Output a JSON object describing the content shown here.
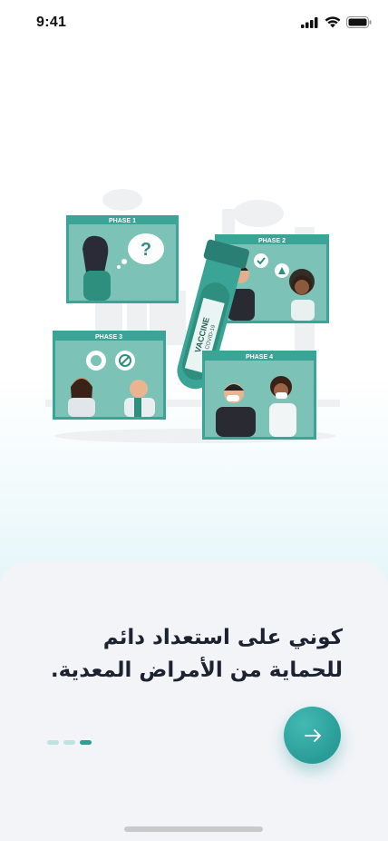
{
  "status_bar": {
    "time": "9:41",
    "signal_icon": "cellular-signal-icon",
    "wifi_icon": "wifi-icon",
    "battery_icon": "battery-icon"
  },
  "illustration": {
    "phases": [
      "PHASE 1",
      "PHASE 2",
      "PHASE 3",
      "PHASE 4"
    ],
    "vial_label": "VACCINE",
    "vial_sublabel": "COVID-19"
  },
  "onboarding": {
    "headline_line1": "كوني على استعداد دائم",
    "headline_line2": "للحماية من الأمراض المعدية.",
    "pager": {
      "total": 3,
      "active": 3
    },
    "next_icon": "arrow-right-icon"
  },
  "colors": {
    "accent": "#2f9e93",
    "card_bg": "#f2f4f8",
    "phase_frame": "#3aa597",
    "phase_fill": "#7cc2b6"
  }
}
